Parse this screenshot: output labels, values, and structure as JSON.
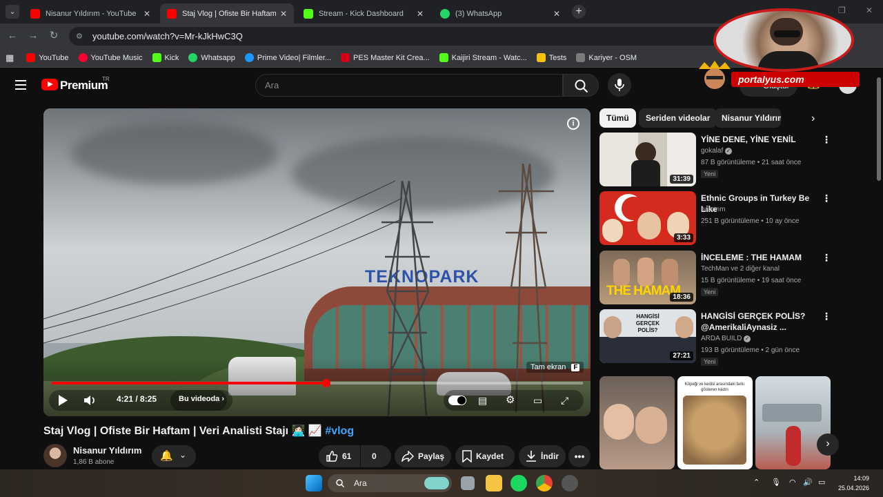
{
  "browser": {
    "tabs": [
      {
        "title": "Nisanur Yıldırım - YouTube",
        "icon": "youtube-icon"
      },
      {
        "title": "Staj Vlog | Ofiste Bir Haftam | Ve",
        "icon": "youtube-icon"
      },
      {
        "title": "Stream - Kick Dashboard",
        "icon": "kick-icon"
      },
      {
        "title": "(3) WhatsApp",
        "icon": "whatsapp-icon"
      }
    ],
    "url": "youtube.com/watch?v=Mr-kJkHwC3Q",
    "bookmarks": [
      {
        "label": "YouTube",
        "color": "#ff0000"
      },
      {
        "label": "YouTube Music",
        "color": "#ff0033"
      },
      {
        "label": "Kick",
        "color": "#53fc18"
      },
      {
        "label": "Whatsapp",
        "color": "#25d366"
      },
      {
        "label": "Prime Video| Filmler...",
        "color": "#1a98ff"
      },
      {
        "label": "PES Master Kit Crea...",
        "color": "#d4001a"
      },
      {
        "label": "Kaijiri Stream - Watc...",
        "color": "#53fc18"
      },
      {
        "label": "Tests",
        "color": "#f4c20d"
      },
      {
        "label": "Kariyer - OSM",
        "color": "#7a7a7a"
      }
    ]
  },
  "youtube": {
    "logo_text": "Premium",
    "country": "TR",
    "search_placeholder": "Ara",
    "create_label": "Oluştur"
  },
  "player": {
    "fullscreen_tooltip": "Tam ekran",
    "fullscreen_key": "F",
    "time": "4:21 / 8:25",
    "chapter": "Bu videoda",
    "progress_fraction": 0.517,
    "building_sign": "TEKNOPARK"
  },
  "video": {
    "title": "Staj Vlog | Ofiste Bir Haftam | Veri Analisti Stajı 👩🏻‍💻 📈",
    "hashtag": "#vlog",
    "channel": "Nisanur Yıldırım",
    "subscribers": "1,86 B abone",
    "likes": "61",
    "dislikes": "0",
    "share": "Paylaş",
    "save": "Kaydet",
    "download": "İndir"
  },
  "sidebar": {
    "chips": [
      "Tümü",
      "Seriden videolar",
      "Nisanur Yıldırım adl"
    ],
    "recommendations": [
      {
        "title": "YİNE DENE, YİNE YENİL",
        "channel": "gokalaf",
        "verified": true,
        "meta": "87 B görüntüleme • 21 saat önce",
        "badge": "Yeni",
        "duration": "31:39"
      },
      {
        "title": "Ethnic Groups in Turkey Be Like",
        "channel": "nazanm",
        "verified": false,
        "meta": "251 B görüntüleme • 10 ay önce",
        "badge": "",
        "duration": "3:33"
      },
      {
        "title": "İNCELEME : THE HAMAM",
        "channel": "TechMan ve 2 diğer kanal",
        "verified": false,
        "meta": "15 B görüntüleme • 19 saat önce",
        "badge": "Yeni",
        "duration": "18:36",
        "thumb_text": "THE HAMAM"
      },
      {
        "title": "HANGİSİ GERÇEK POLİS? @AmerikaliAynasiz ...",
        "channel": "ARDA BUILD",
        "verified": true,
        "meta": "193 B görüntüleme • 2 gün önce",
        "badge": "Yeni",
        "duration": "27:21",
        "thumb_text": "HANGİSİ GERÇEK POLİS?"
      }
    ],
    "short_caption": "Köpeği ve kedisi arasındaki farkı gösteren kadın"
  },
  "stream_overlay": {
    "brand": "portalyus.com"
  },
  "taskbar": {
    "search_placeholder": "Ara",
    "time": "14:09",
    "date": "25.04.2026"
  }
}
